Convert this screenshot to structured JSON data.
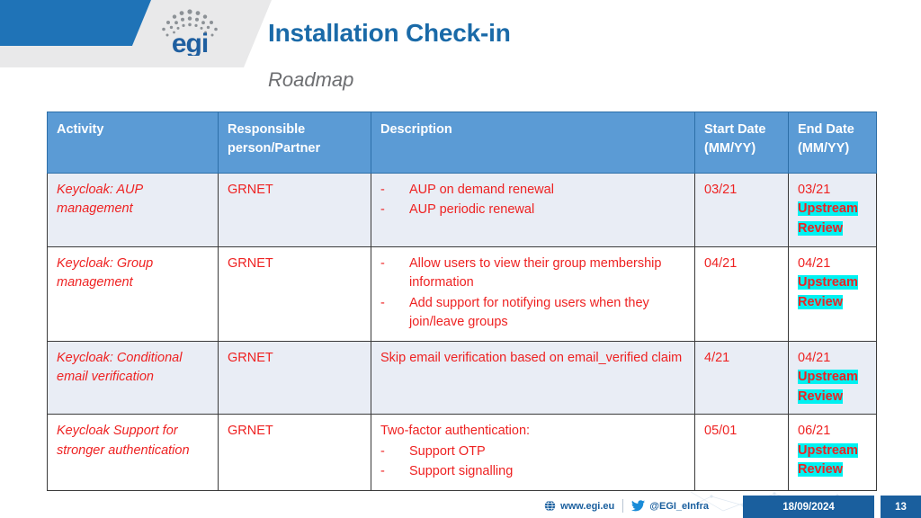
{
  "header": {
    "logo_text": "egi",
    "logo_icon": "egi-logo",
    "title": "Installation Check-in",
    "subtitle": "Roadmap"
  },
  "table": {
    "columns": [
      "Activity",
      "Responsible person/Partner",
      "Description",
      "Start Date (MM/YY)",
      "End Date (MM/YY)"
    ],
    "columns_lines": {
      "activity": [
        "Activity"
      ],
      "responsible": [
        "Responsible",
        "person/Partner"
      ],
      "description": [
        "Description"
      ],
      "start": [
        "Start Date",
        "(MM/YY)"
      ],
      "end": [
        "End Date",
        "(MM/YY)"
      ]
    },
    "rows": [
      {
        "activity": "Keycloak: AUP management",
        "responsible": "GRNET",
        "description_lead": "",
        "description_bullets": [
          "AUP on demand renewal",
          "AUP periodic renewal"
        ],
        "start_date": "03/21",
        "end_date": "03/21",
        "end_status": "Upstream Review"
      },
      {
        "activity": "Keycloak: Group management",
        "responsible": "GRNET",
        "description_lead": "",
        "description_bullets": [
          "Allow users to view their group membership information",
          "Add support for notifying users when they join/leave groups"
        ],
        "start_date": "04/21",
        "end_date": "04/21",
        "end_status": "Upstream Review"
      },
      {
        "activity": "Keycloak: Conditional email verification",
        "responsible": "GRNET",
        "description_lead": "Skip email verification based on email_verified claim",
        "description_bullets": [],
        "start_date": "4/21",
        "end_date": "04/21",
        "end_status": "Upstream Review"
      },
      {
        "activity": "Keycloak Support for stronger authentication",
        "responsible": "GRNET",
        "description_lead": "Two-factor authentication:",
        "description_bullets": [
          "Support OTP",
          "Support signalling"
        ],
        "start_date": "05/01",
        "end_date": "06/21",
        "end_status": "Upstream Review"
      }
    ]
  },
  "footer": {
    "website_icon": "globe-icon",
    "website": "www.egi.eu",
    "twitter_icon": "twitter-bird-icon",
    "twitter_handle": "@EGI_eInfra",
    "date": "18/09/2024",
    "page_number": "13"
  },
  "colors": {
    "brand_blue": "#1f73b7",
    "header_blue": "#5b9bd5",
    "title_blue": "#1a6aa8",
    "text_red": "#ee2222",
    "highlight_cyan": "#00f1f1",
    "row_alt": "#e9edf5",
    "footer_blue": "#1a5f9e",
    "band_grey": "#e9e9ea"
  }
}
